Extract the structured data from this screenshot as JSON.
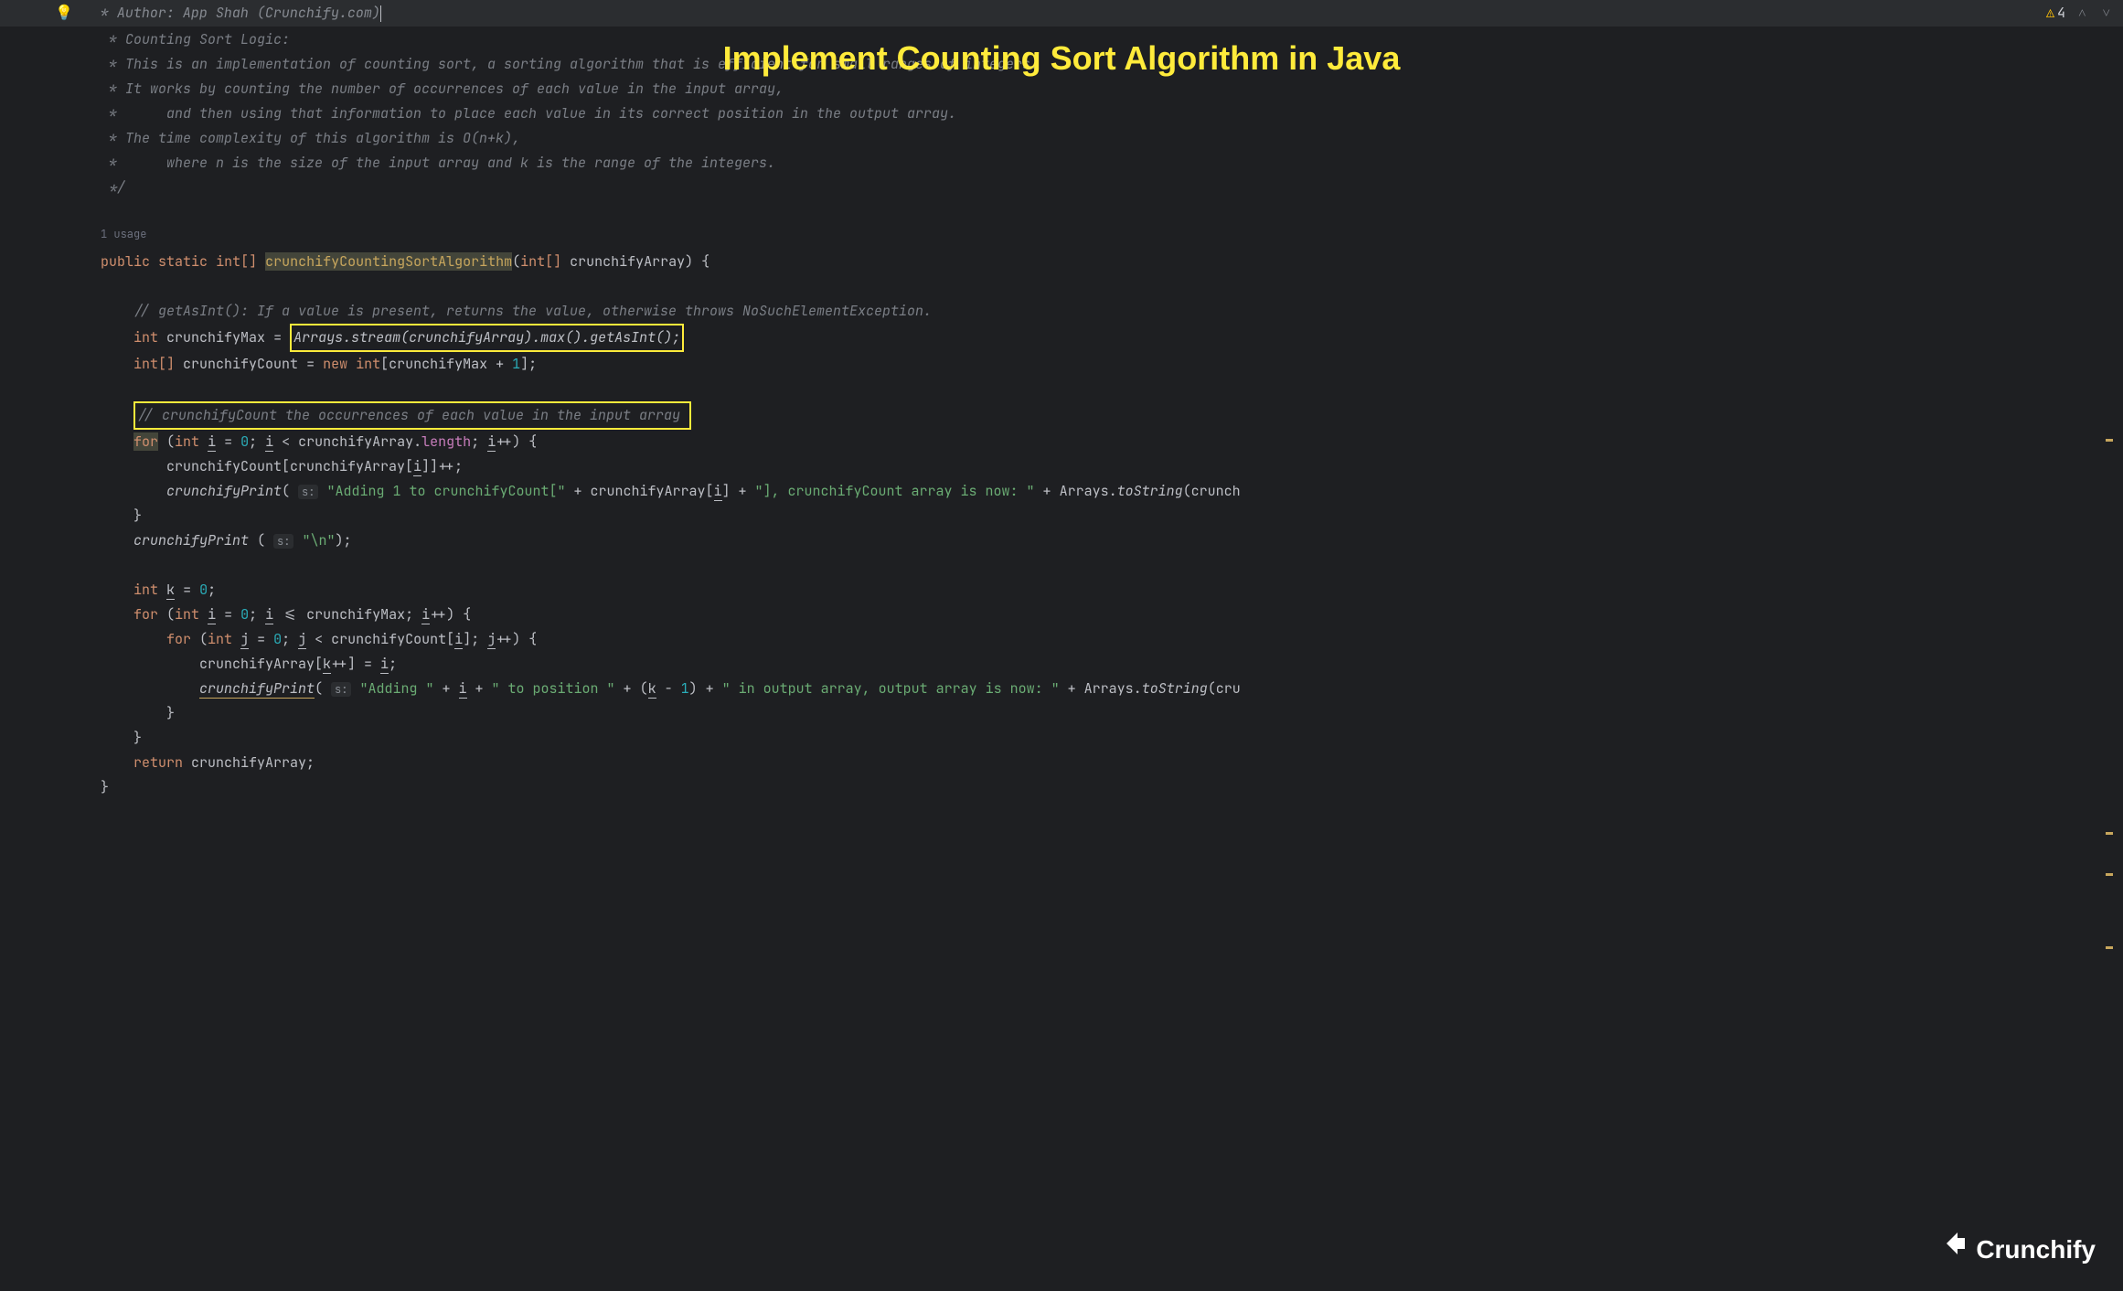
{
  "topBar": {
    "cursorLineText": " * Author: App Shah (Crunchify.com)",
    "warningCount": "4"
  },
  "title": "Implement Counting Sort Algorithm in Java",
  "comments": {
    "line2": " * Counting Sort Logic:",
    "line3": " * This is an implementation of counting sort, a sorting algorithm that is efficient for small ranges of integers.",
    "line4": " * It works by counting the number of occurrences of each value in the input array,",
    "line5": " *      and then using that information to place each value in its correct position in the output array.",
    "line6": " * The time complexity of this algorithm is O(n+k),",
    "line7": " *      where n is the size of the input array and k is the range of the integers.",
    "line8": " */",
    "getAsInt": "// getAsInt(): If a value is present, returns the value, otherwise throws NoSuchElementException.",
    "countOccurrences": "// crunchifyCount the occurrences of each value in the input array"
  },
  "usageLabel": "1 usage",
  "code": {
    "publicKw": "public",
    "staticKw": "static",
    "intArrType": "int[]",
    "intType": "int",
    "newKw": "new",
    "forKw": "for",
    "returnKw": "return",
    "methodName": "crunchifyCountingSortAlgorithm",
    "paramName": "crunchifyArray",
    "crunchifyMax": "crunchifyMax",
    "crunchifyCount": "crunchifyCount",
    "arraysStream": "Arrays.stream(crunchifyArray).max().getAsInt();",
    "maxPlus1": "crunchifyMax + ",
    "one": "1",
    "zero": "0",
    "iVar": "i",
    "jVar": "j",
    "kVar": "k",
    "length": "length",
    "crunchifyPrint": "crunchifyPrint",
    "paramHintS": "s:",
    "str1a": "\"Adding 1 to crunchifyCount[\"",
    "str1b": "\"], crunchifyCount array is now: \"",
    "arraysToString": "Arrays",
    "toStringMethod": "toString",
    "strNewline": "\"\\n\"",
    "str2a": "\"Adding \"",
    "str2b": "\" to position \"",
    "str2c": "\" in output array, output array is now: \"",
    "crunchTruncated1": "crunch",
    "crunchTruncated2": "cru"
  },
  "logo": "Crunchify"
}
